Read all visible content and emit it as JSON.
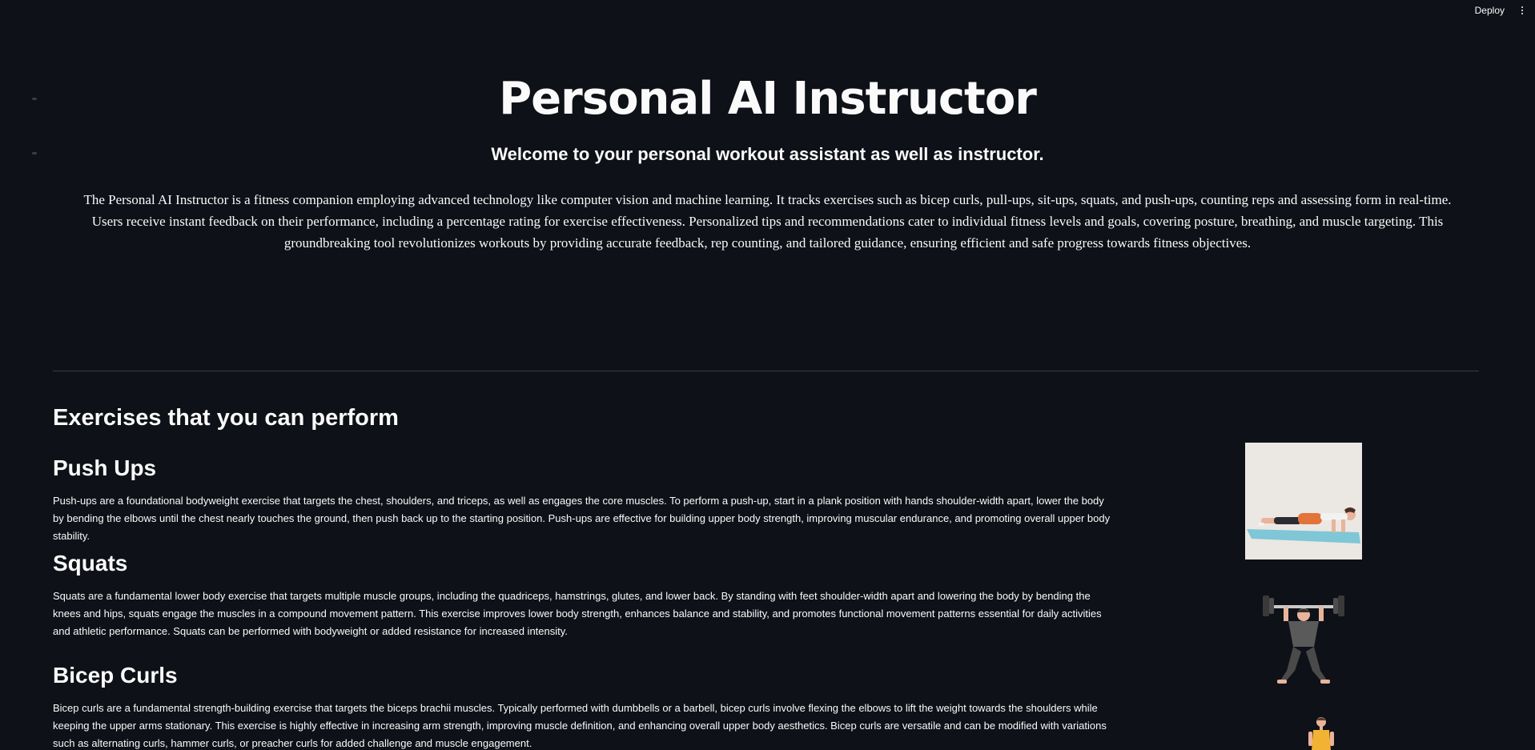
{
  "toolbar": {
    "deploy_label": "Deploy",
    "menu_icon": "vertical-dots-icon"
  },
  "hero": {
    "title": "Personal AI Instructor",
    "subtitle": "Welcome to your personal workout assistant as well as instructor.",
    "description": "The Personal AI Instructor is a fitness companion employing advanced technology like computer vision and machine learning. It tracks exercises such as bicep curls, pull-ups, sit-ups, squats, and push-ups, counting reps and assessing form in real-time. Users receive instant feedback on their performance, including a percentage rating for exercise effectiveness. Personalized tips and recommendations cater to individual fitness levels and goals, covering posture, breathing, and muscle targeting. This groundbreaking tool revolutionizes workouts by providing accurate feedback, rep counting, and tailored guidance, ensuring efficient and safe progress towards fitness objectives."
  },
  "exercises_section": {
    "heading": "Exercises that you can perform",
    "items": [
      {
        "title": "Push Ups",
        "description": "Push-ups are a foundational bodyweight exercise that targets the chest, shoulders, and triceps, as well as engages the core muscles. To perform a push-up, start in a plank position with hands shoulder-width apart, lower the body by bending the elbows until the chest nearly touches the ground, then push back up to the starting position. Push-ups are effective for building upper body strength, improving muscular endurance, and promoting overall upper body stability.",
        "image_icon": "push-up-illustration"
      },
      {
        "title": "Squats",
        "description": "Squats are a fundamental lower body exercise that targets multiple muscle groups, including the quadriceps, hamstrings, glutes, and lower back. By standing with feet shoulder-width apart and lowering the body by bending the knees and hips, squats engage the muscles in a compound movement pattern. This exercise improves lower body strength, enhances balance and stability, and promotes functional movement patterns essential for daily activities and athletic performance. Squats can be performed with bodyweight or added resistance for increased intensity.",
        "image_icon": "barbell-squat-illustration"
      },
      {
        "title": "Bicep Curls",
        "description": "Bicep curls are a fundamental strength-building exercise that targets the biceps brachii muscles. Typically performed with dumbbells or a barbell, bicep curls involve flexing the elbows to lift the weight towards the shoulders while keeping the upper arms stationary. This exercise is highly effective in increasing arm strength, improving muscle definition, and enhancing overall upper body aesthetics. Bicep curls are versatile and can be modified with variations such as alternating curls, hammer curls, or preacher curls for added challenge and muscle engagement.",
        "image_icon": "bicep-curl-illustration"
      }
    ]
  },
  "colors": {
    "background": "#0e1117",
    "text": "#fafafa",
    "divider": "#3a3d45"
  }
}
